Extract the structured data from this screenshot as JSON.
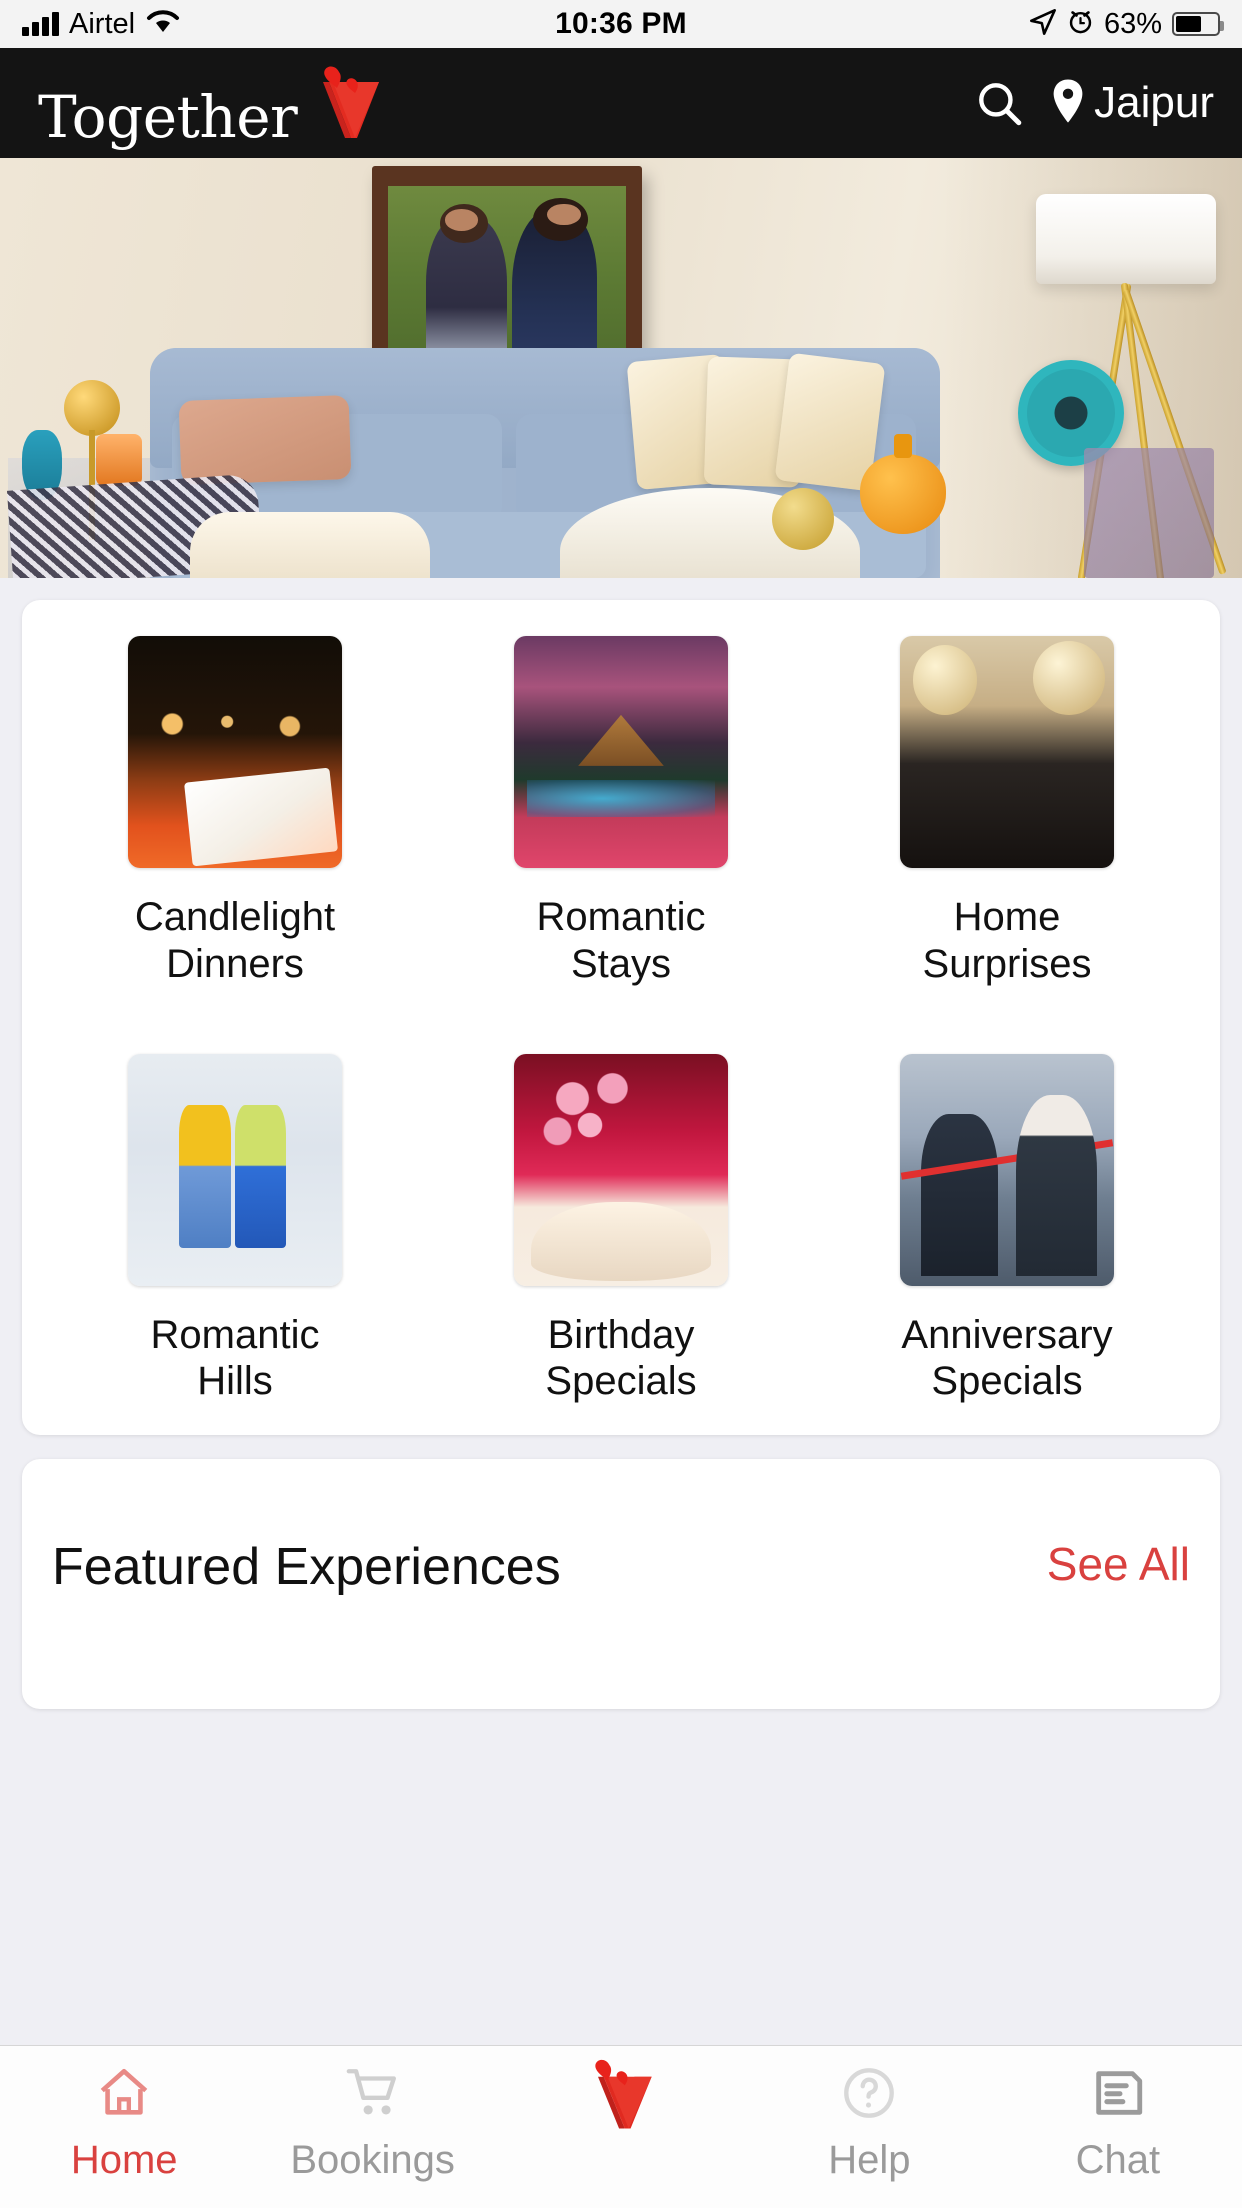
{
  "status_bar": {
    "carrier": "Airtel",
    "signal_icon": "signal-bars-icon",
    "wifi_icon": "wifi-icon",
    "time": "10:36 PM",
    "location_arrow_icon": "location-arrow-icon",
    "alarm_icon": "alarm-clock-icon",
    "battery_percent": "63%",
    "battery_icon": "battery-icon",
    "battery_level": 63
  },
  "header": {
    "logo_text": "Together",
    "logo_mark_icon": "v-heart-logo-icon",
    "search_icon": "search-icon",
    "location_pin_icon": "location-pin-icon",
    "location": "Jaipur",
    "background_color": "#141414"
  },
  "hero": {
    "name": "living-room-banner",
    "description": "Living room with framed couple photo, magnifying glass, blue sofa and floor lamp"
  },
  "categories": {
    "rows": [
      [
        {
          "label": "Candlelight Dinners",
          "image": "candlelight-dinner-thumb",
          "theme": "t-dinner"
        },
        {
          "label": "Romantic Stays",
          "image": "romantic-stay-thumb",
          "theme": "t-stay"
        },
        {
          "label": "Home Surprises",
          "image": "home-surprise-thumb",
          "theme": "t-home"
        }
      ],
      [
        {
          "label": "Romantic Hills",
          "image": "romantic-hills-thumb",
          "theme": "t-hills"
        },
        {
          "label": "Birthday Specials",
          "image": "birthday-special-thumb",
          "theme": "t-bday"
        },
        {
          "label": "Anniversary Specials",
          "image": "anniversary-special-thumb",
          "theme": "t-anniv"
        }
      ]
    ]
  },
  "featured": {
    "title": "Featured Experiences",
    "see_all": "See All",
    "see_all_color": "#d9413f"
  },
  "tabbar": {
    "active_color": "#d9413f",
    "inactive_color": "#9a9a9a",
    "items": [
      {
        "label": "Home",
        "icon": "home-icon",
        "active": true
      },
      {
        "label": "Bookings",
        "icon": "shopping-cart-icon",
        "active": false
      },
      {
        "label": "",
        "icon": "v-heart-logo-icon",
        "active": false
      },
      {
        "label": "Help",
        "icon": "question-circle-icon",
        "active": false
      },
      {
        "label": "Chat",
        "icon": "chat-document-icon",
        "active": false
      }
    ]
  }
}
